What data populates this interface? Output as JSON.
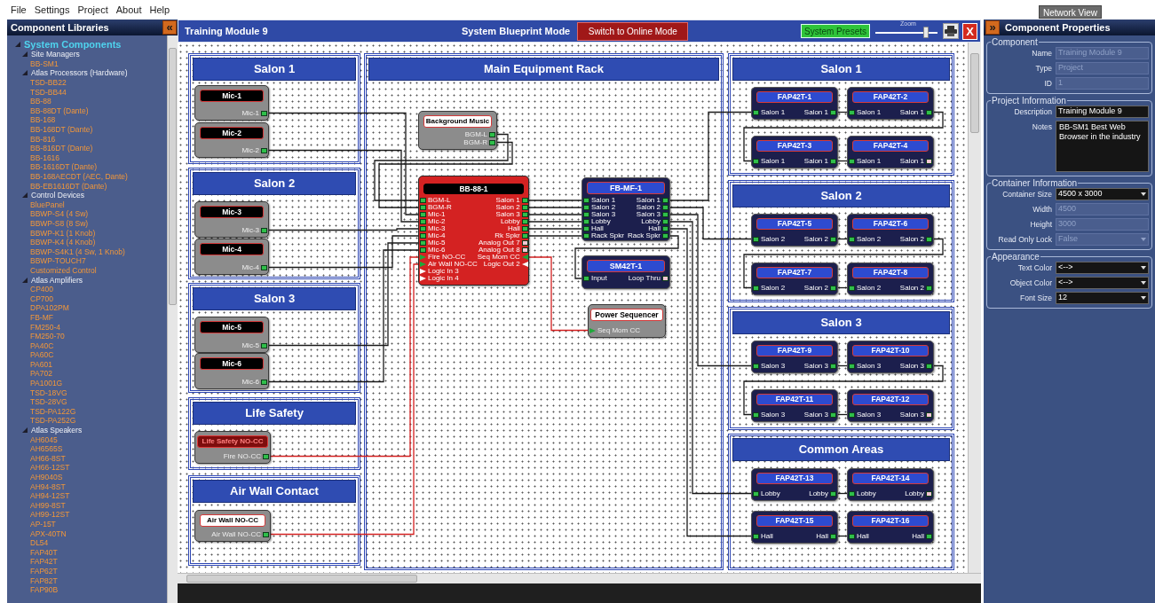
{
  "menu": [
    "File",
    "Settings",
    "Project",
    "About",
    "Help"
  ],
  "network_view_button": "Network View",
  "library": {
    "title": "Component Libraries",
    "collapse_button": "«",
    "tree": [
      {
        "label": "System Components",
        "expanded": true,
        "children": [
          {
            "label": "Site Managers",
            "expanded": true,
            "children": [
              {
                "label": "BB-SM1"
              }
            ]
          },
          {
            "label": "Atlas Processors (Hardware)",
            "expanded": true,
            "children": [
              {
                "label": "TSD-BB22"
              },
              {
                "label": "TSD-BB44"
              },
              {
                "label": "BB-88"
              },
              {
                "label": "BB-88DT (Dante)"
              },
              {
                "label": "BB-168"
              },
              {
                "label": "BB-168DT (Dante)"
              },
              {
                "label": "BB-816"
              },
              {
                "label": "BB-816DT (Dante)"
              },
              {
                "label": "BB-1616"
              },
              {
                "label": "BB-1616DT (Dante)"
              },
              {
                "label": "BB-168AECDT (AEC, Dante)"
              },
              {
                "label": "BB-EB1616DT (Dante)"
              }
            ]
          },
          {
            "label": "Control Devices",
            "expanded": true,
            "children": [
              {
                "label": "BluePanel"
              },
              {
                "label": "BBWP-S4 (4 Sw)"
              },
              {
                "label": "BBWP-S8 (8 Sw)"
              },
              {
                "label": "BBWP-K1 (1 Knob)"
              },
              {
                "label": "BBWP-K4 (4 Knob)"
              },
              {
                "label": "BBWP-S4K1 (4 Sw, 1 Knob)"
              },
              {
                "label": "BBWP-TOUCH7"
              },
              {
                "label": "Customized Control"
              }
            ]
          },
          {
            "label": "Atlas Amplifiers",
            "expanded": true,
            "children": [
              {
                "label": "CP400"
              },
              {
                "label": "CP700"
              },
              {
                "label": "DPA102PM"
              },
              {
                "label": "FB-MF"
              },
              {
                "label": "FM250-4"
              },
              {
                "label": "FM250-70"
              },
              {
                "label": "PA40C"
              },
              {
                "label": "PA60C"
              },
              {
                "label": "PA601"
              },
              {
                "label": "PA702"
              },
              {
                "label": "PA1001G"
              },
              {
                "label": "TSD-18VG"
              },
              {
                "label": "TSD-28VG"
              },
              {
                "label": "TSD-PA122G"
              },
              {
                "label": "TSD-PA252G"
              }
            ]
          },
          {
            "label": "Atlas Speakers",
            "expanded": true,
            "children": [
              {
                "label": "AH6045"
              },
              {
                "label": "AH6565S"
              },
              {
                "label": "AH66-8ST"
              },
              {
                "label": "AH66-12ST"
              },
              {
                "label": "AH9040S"
              },
              {
                "label": "AH94-8ST"
              },
              {
                "label": "AH94-12ST"
              },
              {
                "label": "AH99-8ST"
              },
              {
                "label": "AH99-12ST"
              },
              {
                "label": "AP-15T"
              },
              {
                "label": "APX-40TN"
              },
              {
                "label": "DL54"
              },
              {
                "label": "FAP40T"
              },
              {
                "label": "FAP42T"
              },
              {
                "label": "FAP62T"
              },
              {
                "label": "FAP82T"
              },
              {
                "label": "FAP90B"
              }
            ]
          }
        ]
      }
    ]
  },
  "blueprint": {
    "title": "Training Module 9",
    "mode": "System Blueprint Mode",
    "online_button": "Switch to Online Mode",
    "presets_button": "System Presets",
    "zoom_label": "Zoom",
    "zoom": {
      "level": 0.8
    },
    "close_button": "X"
  },
  "canvas": {
    "zones": [
      {
        "title": "Salon 1",
        "nodes": [
          {
            "kind": "mic",
            "label": "Mic-1",
            "outputs": [
              {
                "label": "Mic-1",
                "kind": "audio",
                "linked": true
              }
            ]
          },
          {
            "kind": "mic",
            "label": "Mic-2",
            "outputs": [
              {
                "label": "Mic-2",
                "kind": "audio",
                "linked": true
              }
            ]
          }
        ]
      },
      {
        "title": "Salon 2",
        "nodes": [
          {
            "kind": "mic",
            "label": "Mic-3",
            "outputs": [
              {
                "label": "Mic-3",
                "kind": "audio",
                "linked": true
              }
            ]
          },
          {
            "kind": "mic",
            "label": "Mic-4",
            "outputs": [
              {
                "label": "Mic-4",
                "kind": "audio",
                "linked": true
              }
            ]
          }
        ]
      },
      {
        "title": "Salon 3",
        "nodes": [
          {
            "kind": "mic",
            "label": "Mic-5",
            "outputs": [
              {
                "label": "Mic-5",
                "kind": "audio",
                "linked": true
              }
            ]
          },
          {
            "kind": "mic",
            "label": "Mic-6",
            "outputs": [
              {
                "label": "Mic-6",
                "kind": "audio",
                "linked": true
              }
            ]
          }
        ]
      },
      {
        "title": "Life Safety",
        "nodes": [
          {
            "kind": "alarm",
            "label": "Life Safety NO-CC",
            "outputs": [
              {
                "label": "Fire NO-CC",
                "kind": "audio",
                "linked": true
              }
            ]
          }
        ]
      },
      {
        "title": "Air Wall Contact",
        "nodes": [
          {
            "kind": "contact",
            "label": "Air Wall NO-CC",
            "outputs": [
              {
                "label": "Air Wall NO-CC",
                "kind": "audio",
                "linked": true
              }
            ]
          }
        ]
      },
      {
        "title": "Main Equipment Rack",
        "nodes": [
          {
            "kind": "source",
            "label": "Background Music",
            "outputs": [
              {
                "label": "BGM-L",
                "kind": "audio",
                "linked": true
              },
              {
                "label": "BGM-R",
                "kind": "audio",
                "linked": true
              }
            ]
          },
          {
            "kind": "dsp",
            "label": "BB-88-1",
            "inputs": [
              {
                "label": "BGM-L",
                "kind": "audio",
                "linked": true
              },
              {
                "label": "BGM-R",
                "kind": "audio",
                "linked": true
              },
              {
                "label": "Mic-1",
                "kind": "audio",
                "linked": true
              },
              {
                "label": "Mic-2",
                "kind": "audio",
                "linked": true
              },
              {
                "label": "Mic-3",
                "kind": "audio",
                "linked": true
              },
              {
                "label": "Mic-4",
                "kind": "audio",
                "linked": true
              },
              {
                "label": "Mic-5",
                "kind": "audio",
                "linked": true
              },
              {
                "label": "Mic-6",
                "kind": "audio",
                "linked": true
              },
              {
                "label": "Fire NO-CC",
                "kind": "logic",
                "linked": true
              },
              {
                "label": "Air Wall NO-CC",
                "kind": "logic",
                "linked": true
              },
              {
                "label": "Logic In 3",
                "kind": "logic",
                "linked": false
              },
              {
                "label": "Logic In 4",
                "kind": "logic",
                "linked": false
              }
            ],
            "outputs": [
              {
                "label": "Salon 1",
                "kind": "audio",
                "linked": true
              },
              {
                "label": "Salon 2",
                "kind": "audio",
                "linked": true
              },
              {
                "label": "Salon 3",
                "kind": "audio",
                "linked": true
              },
              {
                "label": "Lobby",
                "kind": "audio",
                "linked": true
              },
              {
                "label": "Hall",
                "kind": "audio",
                "linked": true
              },
              {
                "label": "Rk Spkr",
                "kind": "audio",
                "linked": true
              },
              {
                "label": "Analog Out 7",
                "kind": "audio",
                "linked": false
              },
              {
                "label": "Analog Out 8",
                "kind": "audio",
                "linked": false
              },
              {
                "label": "Seq Mom CC",
                "kind": "logic",
                "linked": true
              },
              {
                "label": "Logic Out 2",
                "kind": "logic",
                "linked": false
              }
            ]
          },
          {
            "kind": "amp",
            "label": "FB-MF-1",
            "inputs": [
              {
                "label": "Salon 1",
                "kind": "audio",
                "linked": true
              },
              {
                "label": "Salon 2",
                "kind": "audio",
                "linked": true
              },
              {
                "label": "Salon 3",
                "kind": "audio",
                "linked": true
              },
              {
                "label": "Lobby",
                "kind": "audio",
                "linked": true
              },
              {
                "label": "Hall",
                "kind": "audio",
                "linked": true
              },
              {
                "label": "Rack Spkr",
                "kind": "audio",
                "linked": true
              }
            ],
            "outputs": [
              {
                "label": "Salon 1",
                "kind": "audio",
                "linked": true
              },
              {
                "label": "Salon 2",
                "kind": "audio",
                "linked": true
              },
              {
                "label": "Salon 3",
                "kind": "audio",
                "linked": true
              },
              {
                "label": "Lobby",
                "kind": "audio",
                "linked": true
              },
              {
                "label": "Hall",
                "kind": "audio",
                "linked": true
              },
              {
                "label": "Rack Spkr",
                "kind": "audio",
                "linked": true
              }
            ]
          },
          {
            "kind": "amp",
            "label": "SM42T-1",
            "inputs": [
              {
                "label": "Input",
                "kind": "audio",
                "linked": true
              }
            ],
            "outputs": [
              {
                "label": "Loop Thru",
                "kind": "audio",
                "linked": false
              }
            ]
          },
          {
            "kind": "sequencer",
            "label": "Power Sequencer",
            "inputs": [
              {
                "label": "Seq Mom CC",
                "kind": "logic",
                "linked": true
              }
            ]
          }
        ]
      },
      {
        "title": "Salon 1",
        "nodes": [
          {
            "kind": "speaker",
            "label": "FAP42T-1",
            "inputs": [
              {
                "label": "Salon 1",
                "kind": "audio",
                "linked": true
              }
            ],
            "outputs": [
              {
                "label": "Salon 1",
                "kind": "audio",
                "linked": true
              }
            ]
          },
          {
            "kind": "speaker",
            "label": "FAP42T-2",
            "inputs": [
              {
                "label": "Salon 1",
                "kind": "audio",
                "linked": true
              }
            ],
            "outputs": [
              {
                "label": "Salon 1",
                "kind": "audio",
                "linked": true
              }
            ]
          },
          {
            "kind": "speaker",
            "label": "FAP42T-3",
            "inputs": [
              {
                "label": "Salon 1",
                "kind": "audio",
                "linked": true
              }
            ],
            "outputs": [
              {
                "label": "Salon 1",
                "kind": "audio",
                "linked": true
              }
            ]
          },
          {
            "kind": "speaker",
            "label": "FAP42T-4",
            "inputs": [
              {
                "label": "Salon 1",
                "kind": "audio",
                "linked": true
              }
            ],
            "outputs": [
              {
                "label": "Salon 1",
                "kind": "audio",
                "linked": false
              }
            ]
          }
        ]
      },
      {
        "title": "Salon 2",
        "nodes": [
          {
            "kind": "speaker",
            "label": "FAP42T-5",
            "inputs": [
              {
                "label": "Salon 2",
                "kind": "audio",
                "linked": true
              }
            ],
            "outputs": [
              {
                "label": "Salon 2",
                "kind": "audio",
                "linked": true
              }
            ]
          },
          {
            "kind": "speaker",
            "label": "FAP42T-6",
            "inputs": [
              {
                "label": "Salon 2",
                "kind": "audio",
                "linked": true
              }
            ],
            "outputs": [
              {
                "label": "Salon 2",
                "kind": "audio",
                "linked": true
              }
            ]
          },
          {
            "kind": "speaker",
            "label": "FAP42T-7",
            "inputs": [
              {
                "label": "Salon 2",
                "kind": "audio",
                "linked": true
              }
            ],
            "outputs": [
              {
                "label": "Salon 2",
                "kind": "audio",
                "linked": true
              }
            ]
          },
          {
            "kind": "speaker",
            "label": "FAP42T-8",
            "inputs": [
              {
                "label": "Salon 2",
                "kind": "audio",
                "linked": true
              }
            ],
            "outputs": [
              {
                "label": "Salon 2",
                "kind": "audio",
                "linked": true
              }
            ]
          }
        ]
      },
      {
        "title": "Salon 3",
        "nodes": [
          {
            "kind": "speaker",
            "label": "FAP42T-9",
            "inputs": [
              {
                "label": "Salon 3",
                "kind": "audio",
                "linked": true
              }
            ],
            "outputs": [
              {
                "label": "Salon 3",
                "kind": "audio",
                "linked": true
              }
            ]
          },
          {
            "kind": "speaker",
            "label": "FAP42T-10",
            "inputs": [
              {
                "label": "Salon 3",
                "kind": "audio",
                "linked": true
              }
            ],
            "outputs": [
              {
                "label": "Salon 3",
                "kind": "audio",
                "linked": true
              }
            ]
          },
          {
            "kind": "speaker",
            "label": "FAP42T-11",
            "inputs": [
              {
                "label": "Salon 3",
                "kind": "audio",
                "linked": true
              }
            ],
            "outputs": [
              {
                "label": "Salon 3",
                "kind": "audio",
                "linked": true
              }
            ]
          },
          {
            "kind": "speaker",
            "label": "FAP42T-12",
            "inputs": [
              {
                "label": "Salon 3",
                "kind": "audio",
                "linked": true
              }
            ],
            "outputs": [
              {
                "label": "Salon 3",
                "kind": "audio",
                "linked": false
              }
            ]
          }
        ]
      },
      {
        "title": "Common Areas",
        "nodes": [
          {
            "kind": "speaker",
            "label": "FAP42T-13",
            "inputs": [
              {
                "label": "Lobby",
                "kind": "audio",
                "linked": true
              }
            ],
            "outputs": [
              {
                "label": "Lobby",
                "kind": "audio",
                "linked": true
              }
            ]
          },
          {
            "kind": "speaker",
            "label": "FAP42T-14",
            "inputs": [
              {
                "label": "Lobby",
                "kind": "audio",
                "linked": true
              }
            ],
            "outputs": [
              {
                "label": "Lobby",
                "kind": "audio",
                "linked": false
              }
            ]
          },
          {
            "kind": "speaker",
            "label": "FAP42T-15",
            "inputs": [
              {
                "label": "Hall",
                "kind": "audio",
                "linked": true
              }
            ],
            "outputs": [
              {
                "label": "Hall",
                "kind": "audio",
                "linked": true
              }
            ]
          },
          {
            "kind": "speaker",
            "label": "FAP42T-16",
            "inputs": [
              {
                "label": "Hall",
                "kind": "audio",
                "linked": true
              }
            ],
            "outputs": [
              {
                "label": "Hall",
                "kind": "audio",
                "linked": true
              }
            ]
          }
        ]
      }
    ]
  },
  "properties": {
    "title": "Component Properties",
    "expand_button": "»",
    "groups": [
      {
        "title": "Component",
        "fields": [
          {
            "label": "Name",
            "kind": "text",
            "value": "Training Module 9",
            "disabled": true
          },
          {
            "label": "Type",
            "kind": "text",
            "value": "Project",
            "disabled": true
          },
          {
            "label": "ID",
            "kind": "text",
            "value": "1",
            "disabled": true
          }
        ]
      },
      {
        "title": "Project Information",
        "fields": [
          {
            "label": "Description",
            "kind": "text",
            "value": "Training Module 9",
            "disabled": false
          },
          {
            "label": "Notes",
            "kind": "textarea",
            "value": "BB-SM1 Best Web Browser in the industry",
            "disabled": false
          }
        ]
      },
      {
        "title": "Container Information",
        "fields": [
          {
            "label": "Container Size",
            "kind": "dropdown",
            "value": "4500 x 3000",
            "disabled": false
          },
          {
            "label": "Width",
            "kind": "text",
            "value": "4500",
            "disabled": true
          },
          {
            "label": "Height",
            "kind": "text",
            "value": "3000",
            "disabled": true
          },
          {
            "label": "Read Only Lock",
            "kind": "dropdown",
            "value": "False",
            "disabled": true
          }
        ]
      },
      {
        "title": "Appearance",
        "fields": [
          {
            "label": "Text Color",
            "kind": "dropdown",
            "value": "<-->",
            "disabled": false
          },
          {
            "label": "Object Color",
            "kind": "dropdown",
            "value": "<-->",
            "disabled": false
          },
          {
            "label": "Font Size",
            "kind": "dropdown",
            "value": "12",
            "disabled": false
          }
        ]
      }
    ]
  }
}
